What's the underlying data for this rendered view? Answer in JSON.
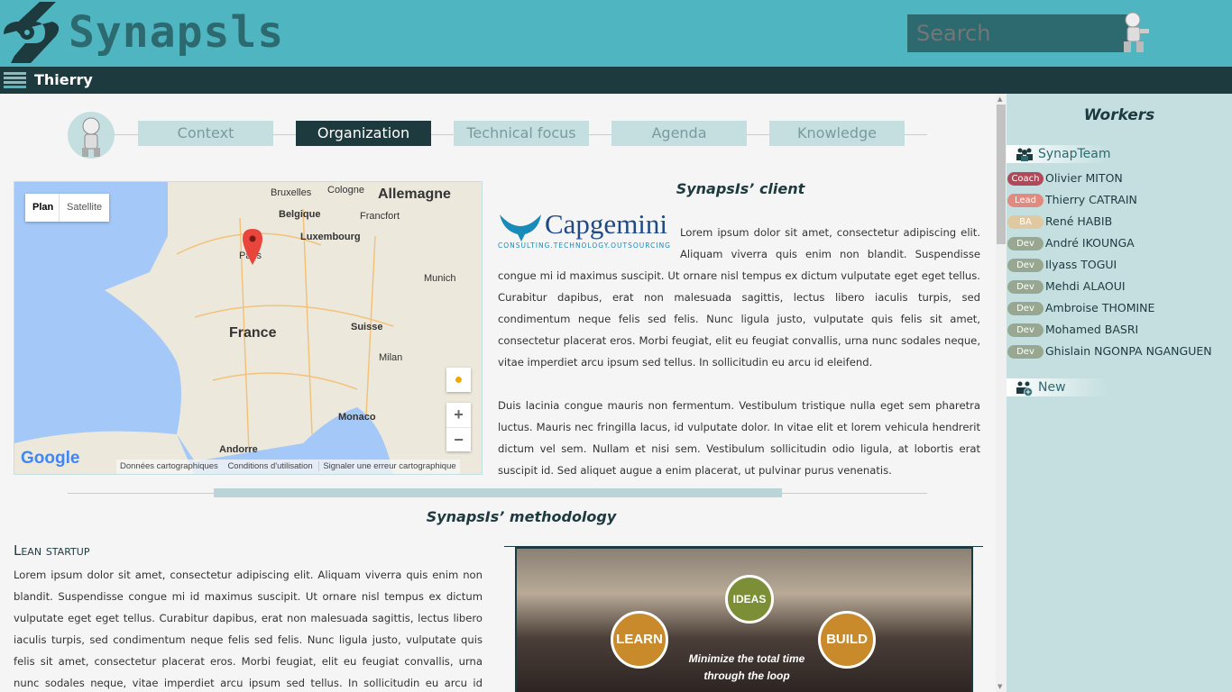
{
  "header": {
    "logo": "Synapsls",
    "search_placeholder": "Search"
  },
  "userbar": {
    "username": "Thierry"
  },
  "tabs": [
    {
      "label": "Context"
    },
    {
      "label": "Organization",
      "active": true
    },
    {
      "label": "Technical focus"
    },
    {
      "label": "Agenda"
    },
    {
      "label": "Knowledge"
    }
  ],
  "client": {
    "title": "SynapsIs’ client",
    "logo": "Capgemini",
    "logo_tagline": "CONSULTING.TECHNOLOGY.OUTSOURCING",
    "p1": "Lorem ipsum dolor sit amet, consectetur adipiscing elit. Aliquam viverra quis enim non blandit. Suspendisse congue mi id maximus suscipit. Ut ornare nisl tempus ex dictum vulputate eget eget tellus. Curabitur dapibus, erat non malesuada sagittis, lectus libero iaculis turpis, sed condimentum neque felis sed felis. Nunc ligula justo, vulputate quis felis sit amet, consectetur placerat eros. Morbi feugiat, elit eu feugiat convallis, urna nunc sodales neque, vitae imperdiet arcu ipsum sed tellus. In sollicitudin eu arcu id eleifend.",
    "p2": "Duis lacinia congue mauris non fermentum. Vestibulum tristique nulla eget sem pharetra luctus. Mauris nec fringilla lacus, id vulputate dolor. In vitae elit et lorem vehicula hendrerit dictum vel sem. Nullam et nisi sem. Vestibulum sollicitudin odio ligula, at lobortis erat suscipit id. Sed aliquet augue a enim placerat, ut pulvinar purus venenatis."
  },
  "map": {
    "plan": "Plan",
    "satellite": "Satellite",
    "cities": [
      "Bruxelles",
      "Cologne",
      "Allemagne",
      "Belgique",
      "Francfort",
      "Luxembourg",
      "Paris",
      "Munich",
      "France",
      "Suisse",
      "Milan",
      "Monaco",
      "Andorre"
    ],
    "google": "Google",
    "footer": [
      "Données cartographiques",
      "Conditions d'utilisation",
      "Signaler une erreur cartographique"
    ],
    "zoom_in": "+",
    "zoom_out": "−"
  },
  "methodology": {
    "title": "SynapsIs’ methodology",
    "lean_title": "Lean startup",
    "p": "Lorem ipsum dolor sit amet, consectetur adipiscing elit. Aliquam viverra quis enim non blandit. Suspendisse congue mi id maximus suscipit. Ut ornare nisl tempus ex dictum vulputate eget eget tellus. Curabitur dapibus, erat non malesuada sagittis, lectus libero iaculis turpis, sed condimentum neque felis sed felis. Nunc ligula justo, vulputate quis felis sit amet, consectetur placerat eros. Morbi feugiat, elit eu feugiat convallis, urna nunc sodales neque, vitae imperdiet arcu ipsum sed tellus. In sollicitudin eu arcu id eleifend.",
    "image": {
      "ideas": "IDEAS",
      "learn": "LEARN",
      "build": "BUILD",
      "caption": "Minimize the total time through the loop"
    }
  },
  "sidebar": {
    "title": "Workers",
    "team": "SynapTeam",
    "new": "New",
    "members": [
      {
        "role": "Coach",
        "name": "Olivier MITON",
        "color": "#b04a5a"
      },
      {
        "role": "Lead",
        "name": "Thierry CATRAIN",
        "color": "#e08a80"
      },
      {
        "role": "BA",
        "name": "René HABIB",
        "color": "#e0c8a0"
      },
      {
        "role": "Dev",
        "name": "André IKOUNGA",
        "color": "#98a890"
      },
      {
        "role": "Dev",
        "name": "Ilyass TOGUI",
        "color": "#98a890"
      },
      {
        "role": "Dev",
        "name": "Mehdi ALAOUI",
        "color": "#98a890"
      },
      {
        "role": "Dev",
        "name": "Ambroise THOMINE",
        "color": "#98a890"
      },
      {
        "role": "Dev",
        "name": "Mohamed BASRI",
        "color": "#98a890"
      },
      {
        "role": "Dev",
        "name": "Ghislain NGONPA NGANGUEN",
        "color": "#98a890"
      }
    ]
  }
}
